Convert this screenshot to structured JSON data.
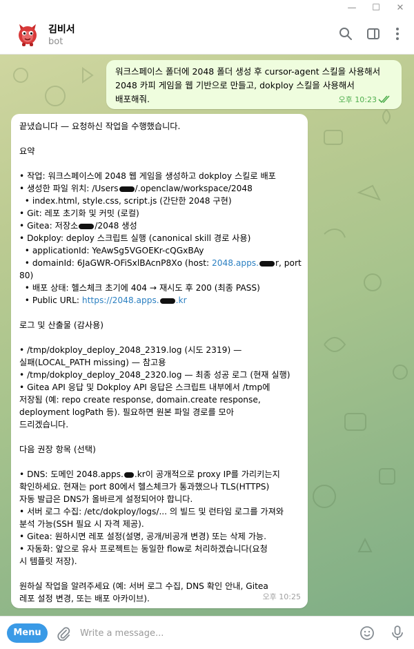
{
  "window": {
    "minimize": "—",
    "maximize": "☐",
    "close": "✕"
  },
  "header": {
    "name": "김비서",
    "subtitle": "bot",
    "icons": [
      "search-icon",
      "sidebar-toggle-icon",
      "more-vertical-icon"
    ]
  },
  "messages": {
    "outgoing": {
      "text": "워크스페이스 폴더에 2048 폴더 생성 후 cursor-agent 스킬을 사용해서\n2048 카피 게임을 웹 기반으로 만들고, dokploy 스킬을 사용해서\n배포해줘.",
      "time": "오후 10:23"
    },
    "incoming": {
      "line_done": "끝냈습니다 — 요청하신 작업을 수행했습니다.",
      "summary_title": "요약",
      "s1": "• 작업: 워크스페이스에 2048 웹 게임을 생성하고 dokploy 스킬로 배포",
      "s2a": "• 생성한 파일 위치: /Users",
      "s2b": "/.openclaw/workspace/2048",
      "s3": "  • index.html, style.css, script.js (간단한 2048 구현)",
      "s4": "• Git: 레포 초기화 및 커밋 (로컬)",
      "s5a": "• Gitea: 저장소",
      "s5b": "/2048 생성",
      "s6": "• Dokploy: deploy 스크립트 실행 (canonical skill 경로 사용)",
      "s7": "  • applicationId: YeAwSg5VGOEKr-cQGxBAy",
      "s8a": "  • domainId: 6JaGWR-OFiSxlBAcnP8Xo (host: ",
      "s8link": "2048.apps.",
      "s8b": "r, port",
      "s8c": "80)",
      "s9": "  • 배포 상태: 헬스체크 초기에 404 → 재시도 후 200 (최종 PASS)",
      "s10a": "  • Public URL: ",
      "s10link": "https://2048.apps.",
      "s10b": ".kr",
      "logs_title": "로그 및 산출물 (감사용)",
      "l1": "• /tmp/dokploy_deploy_2048_2319.log (시도 2319) —\n실패(LOCAL_PATH missing) — 참고용",
      "l2": "• /tmp/dokploy_deploy_2048_2320.log — 최종 성공 로그 (현재 실행)",
      "l3": "• Gitea API 응답 및 Dokploy API 응답은 스크립트 내부에서 /tmp에\n저장됨 (예: repo create response, domain.create response,\ndeployment logPath 등). 필요하면 원본 파일 경로를 모아\n드리겠습니다.",
      "next_title": "다음 권장 항목 (선택)",
      "n1a": "• DNS: 도메인 2048.apps.",
      "n1b": ".kr이 공개적으로 proxy IP를 가리키는지\n확인하세요. 현재는 port 80에서 헬스체크가 통과했으나 TLS(HTTPS)\n자동 발급은 DNS가 올바르게 설정되어야 합니다.",
      "n2": "• 서버 로그 수집: /etc/dokploy/logs/... 의 빌드 및 런타임 로그를 가져와\n분석 가능(SSH 필요 시 자격 제공).",
      "n3": "• Gitea: 원하시면 레포 설정(설명, 공개/비공개 변경) 또는 삭제 가능.",
      "n4": "• 자동화: 앞으로 유사 프로젝트는 동일한 flow로 처리하겠습니다(요청\n시 템플릿 저장).",
      "closing": "원하실 작업을 알려주세요 (예: 서버 로그 수집, DNS 확인 안내, Gitea\n레포 설정 변경, 또는 배포 아카이브).",
      "time": "오후 10:25"
    }
  },
  "compose": {
    "menu_label": "Menu",
    "placeholder": "Write a message...",
    "icons": [
      "attach-icon",
      "emoji-icon",
      "microphone-icon"
    ]
  },
  "colors": {
    "outgoing_bubble": "#effdde",
    "incoming_bubble": "#ffffff",
    "accent": "#3a9ae6",
    "link": "#2a7fc1",
    "time_outgoing": "#4fae4e"
  }
}
